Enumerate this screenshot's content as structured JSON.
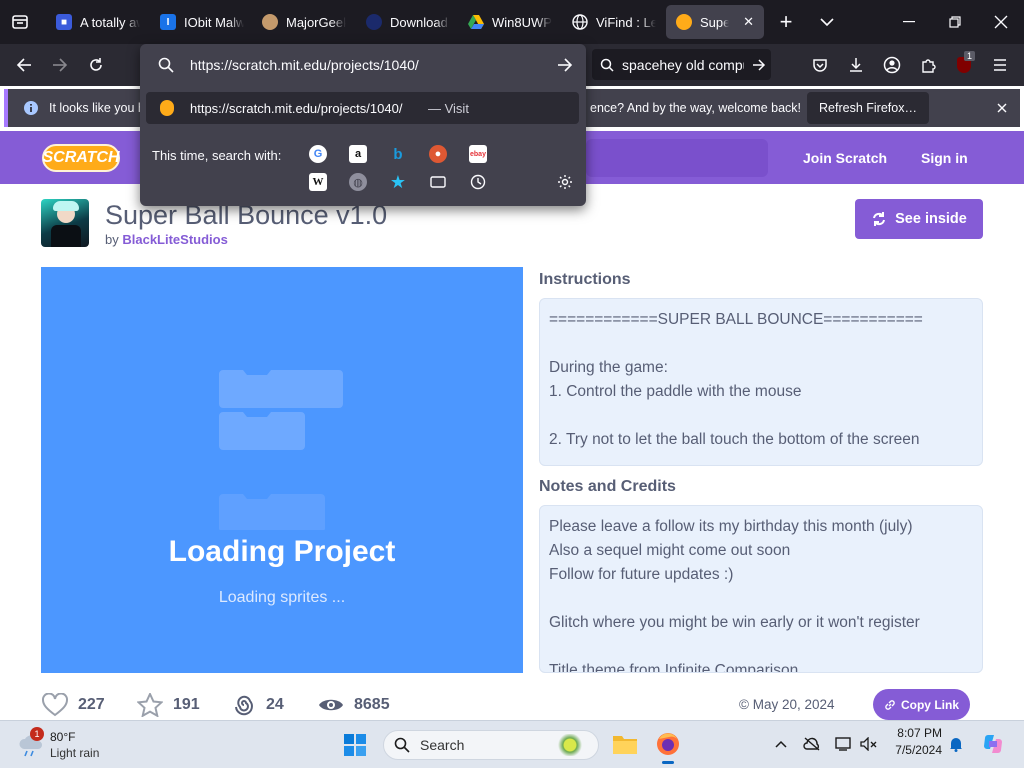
{
  "browser": {
    "tabs": [
      {
        "label": "A totally awesome",
        "fav_color": "#3b5bdb",
        "fav_text": "A"
      },
      {
        "label": "IObit Malware",
        "fav_color": "#1a73e8",
        "fav_text": "I"
      },
      {
        "label": "MajorGeeks",
        "fav_color": "#c49a6c",
        "fav_text": "M"
      },
      {
        "label": "Download",
        "fav_color": "#1b2a6b",
        "fav_text": ""
      },
      {
        "label": "Win8UWP",
        "fav_color": "#34a853",
        "fav_text": ""
      },
      {
        "label": "ViFind : Learn",
        "fav_color": "#2b2a33",
        "fav_text": ""
      },
      {
        "label": "Super Ball",
        "fav_color": "#ffab19",
        "fav_text": "",
        "active": true
      }
    ],
    "url": "https://scratch.mit.edu/projects/1040/",
    "suggestion_url": "https://scratch.mit.edu/projects/1040/",
    "suggestion_action": "— Visit",
    "search_with_label": "This time, search with:",
    "search_box_value": "spacehey old compu",
    "notification_left": "It looks like you ha",
    "notification_right": "ence? And by the way, welcome back!",
    "refresh_label": "Refresh Firefox…",
    "profile_badge": "1"
  },
  "scratch": {
    "logo_text": "SCRATCH",
    "join": "Join Scratch",
    "signin": "Sign in",
    "title": "Super Ball Bounce v1.0",
    "by": "by",
    "author": "BlackLiteStudios",
    "see_inside": "See inside",
    "loading_title": "Loading Project",
    "loading_sub": "Loading sprites ...",
    "instructions_title": "Instructions",
    "instructions": [
      "============SUPER BALL BOUNCE===========",
      "",
      "During the game:",
      "1. Control the paddle with the mouse",
      "",
      "2. Try not to let the ball touch the bottom of the screen"
    ],
    "notes_title": "Notes and Credits",
    "notes": [
      "Please leave a follow its my birthday this month (july)",
      "Also a sequel might come out soon",
      "Follow for future updates :)",
      "",
      "Glitch where you might be win early or it won't register",
      "",
      "Title theme from Infinite Comparison"
    ],
    "loves": "227",
    "favorites": "191",
    "remixes": "24",
    "views": "8685",
    "date": "© May 20, 2024",
    "copy_link": "Copy Link",
    "accent": "#855cd6",
    "stage_color": "#4c97ff"
  },
  "taskbar": {
    "temp": "80°F",
    "condition": "Light rain",
    "weather_badge": "1",
    "search": "Search",
    "time": "8:07 PM",
    "date": "7/5/2024"
  }
}
